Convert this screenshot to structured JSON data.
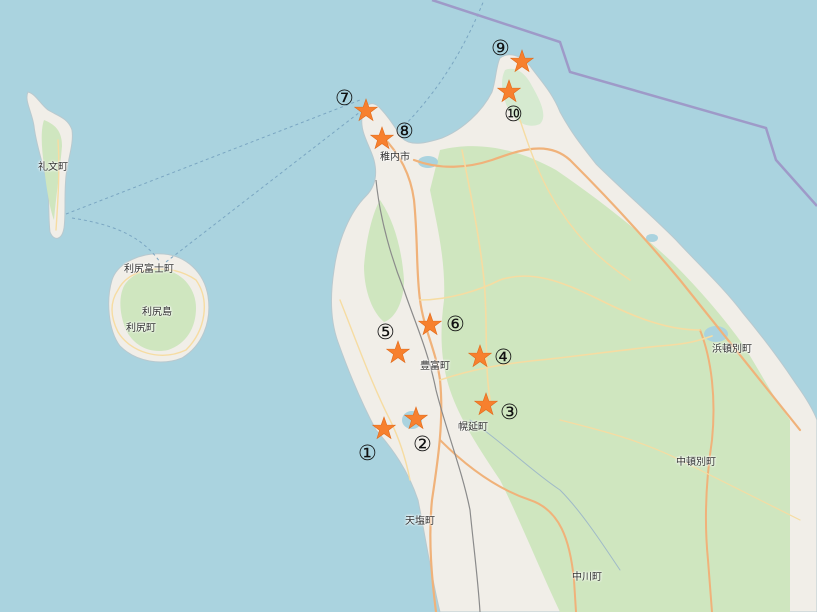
{
  "map": {
    "colors": {
      "sea": "#aad3df",
      "land": "#f1eee8",
      "forest": "#cfe6bf",
      "road_primary": "#f0b27a",
      "road_secondary": "#f6dca2",
      "border": "#9e9ac8",
      "marker": "#f7802e"
    },
    "places": {
      "rebun": "礼文町",
      "rishirifuji": "利尻富士町",
      "rishiri_island": "利尻島",
      "rishiri": "利尻町",
      "wakkanai": "稚内市",
      "toyotomi": "豊富町",
      "horonobe": "幌延町",
      "hamatonbetsu": "浜頓別町",
      "nakatonbetsu": "中頓別町",
      "teshio": "天塩町",
      "nakagawa": "中川町"
    },
    "markers": [
      {
        "label": "①",
        "icon": "star-icon"
      },
      {
        "label": "②",
        "icon": "star-icon"
      },
      {
        "label": "③",
        "icon": "star-icon"
      },
      {
        "label": "④",
        "icon": "star-icon"
      },
      {
        "label": "⑤",
        "icon": "star-icon"
      },
      {
        "label": "⑥",
        "icon": "star-icon"
      },
      {
        "label": "⑦",
        "icon": "star-icon"
      },
      {
        "label": "⑧",
        "icon": "star-icon"
      },
      {
        "label": "⑨",
        "icon": "star-icon"
      },
      {
        "label": "⑩",
        "icon": "star-icon"
      }
    ]
  }
}
